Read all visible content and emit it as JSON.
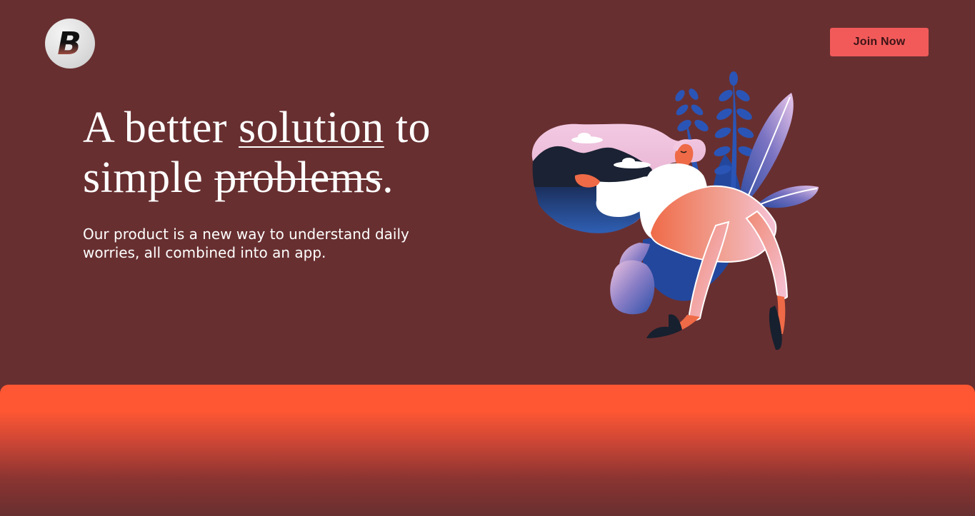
{
  "header": {
    "logo_letter": "B",
    "join_label": "Join Now"
  },
  "hero": {
    "headline_part1": "A better ",
    "headline_underlined": "solution",
    "headline_part2": " to simple ",
    "headline_struck": "problems",
    "headline_end": ".",
    "subtext": " Our product is a new way to understand daily\nworries, all combined into an app."
  },
  "colors": {
    "background": "#682f30",
    "accent_button": "#f25a5a",
    "band_orange": "#ff5733",
    "text": "#ffffff"
  },
  "icons": {
    "logo": "brand-logo-icon",
    "illustration": "floating-woman-illustration"
  }
}
